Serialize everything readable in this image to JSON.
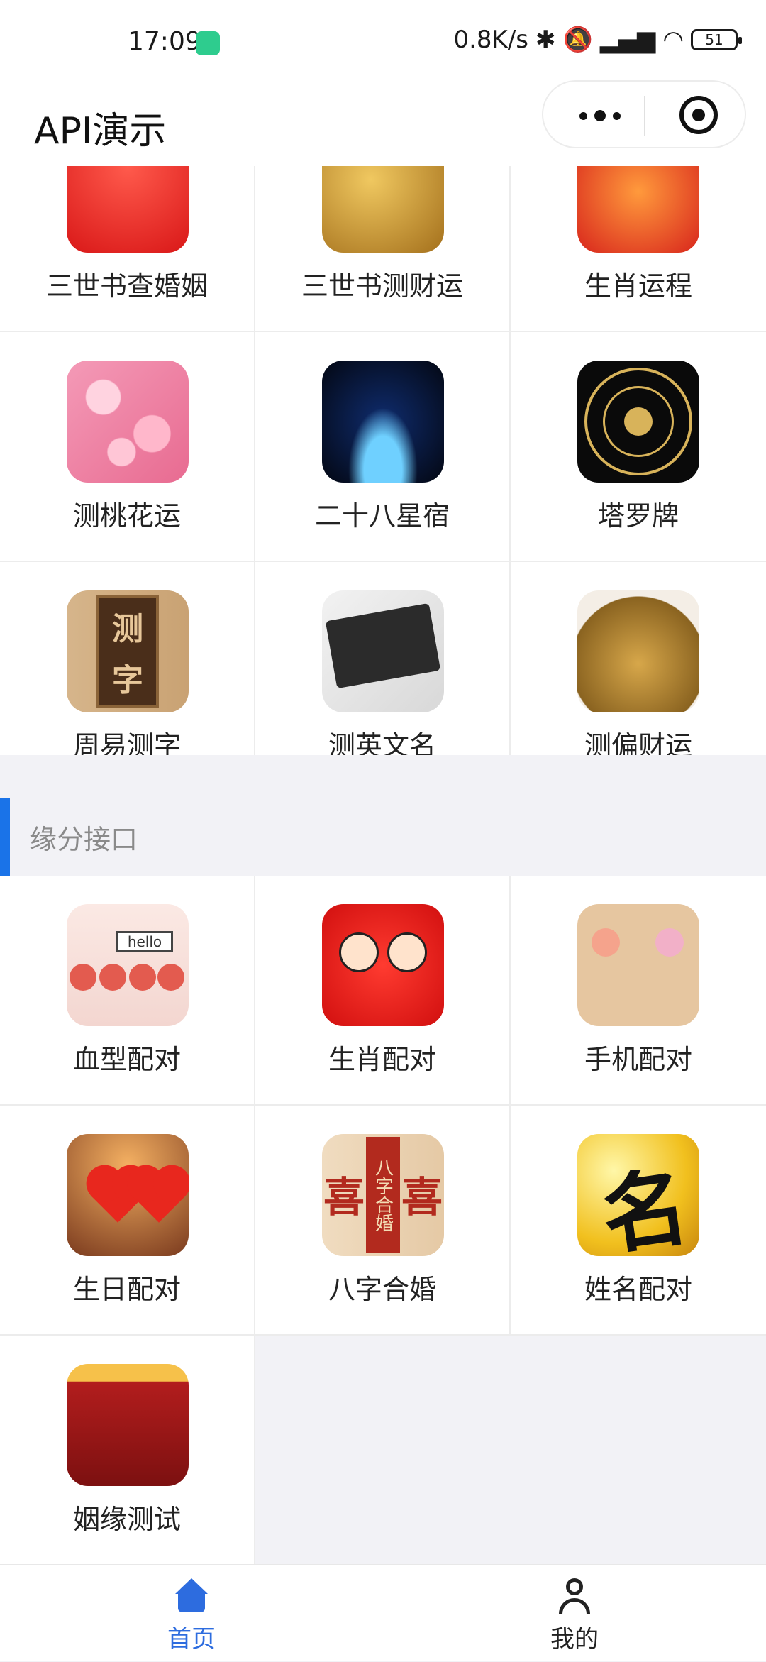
{
  "status_bar": {
    "time": "17:09",
    "network_speed": "0.8K/s",
    "battery": "51",
    "icons": [
      "app-notification-icon",
      "bluetooth-icon",
      "mute-bell-icon",
      "hd-signal-icon",
      "wifi-icon",
      "battery-icon"
    ]
  },
  "nav": {
    "title": "API演示"
  },
  "top_grid": [
    {
      "label": "三世书查婚姻",
      "icon": "couple-icon"
    },
    {
      "label": "三世书测财运",
      "icon": "coins-icon"
    },
    {
      "label": "生肖运程",
      "icon": "lantern-icon"
    },
    {
      "label": "测桃花运",
      "icon": "peach-blossom-icon"
    },
    {
      "label": "二十八星宿",
      "icon": "starry-sky-icon"
    },
    {
      "label": "塔罗牌",
      "icon": "tarot-wheel-icon"
    },
    {
      "label": "周易测字",
      "icon": "test-character-icon",
      "art_text": [
        "测",
        "字"
      ]
    },
    {
      "label": "测英文名",
      "icon": "english-names-board-icon"
    },
    {
      "label": "测偏财运",
      "icon": "golden-toad-icon"
    }
  ],
  "section": {
    "title": "缘分接口"
  },
  "bottom_grid": [
    {
      "label": "血型配对",
      "icon": "blood-type-hello-icon",
      "art_text": "hello"
    },
    {
      "label": "生肖配对",
      "icon": "bride-groom-icon"
    },
    {
      "label": "手机配对",
      "icon": "phone-couple-icon"
    },
    {
      "label": "生日配对",
      "icon": "two-hearts-icon"
    },
    {
      "label": "八字合婚",
      "icon": "double-happiness-icon",
      "art_text": [
        "喜",
        "八字合婚",
        "喜"
      ]
    },
    {
      "label": "姓名配对",
      "icon": "name-character-icon",
      "art_text": "名"
    },
    {
      "label": "姻缘测试",
      "icon": "wishing-wall-icon"
    }
  ],
  "tab_bar": {
    "home_label": "首页",
    "mine_label": "我的"
  },
  "colors": {
    "accent": "#2d6cdf",
    "section_bar": "#1a73e8",
    "background": "#f2f2f6"
  }
}
